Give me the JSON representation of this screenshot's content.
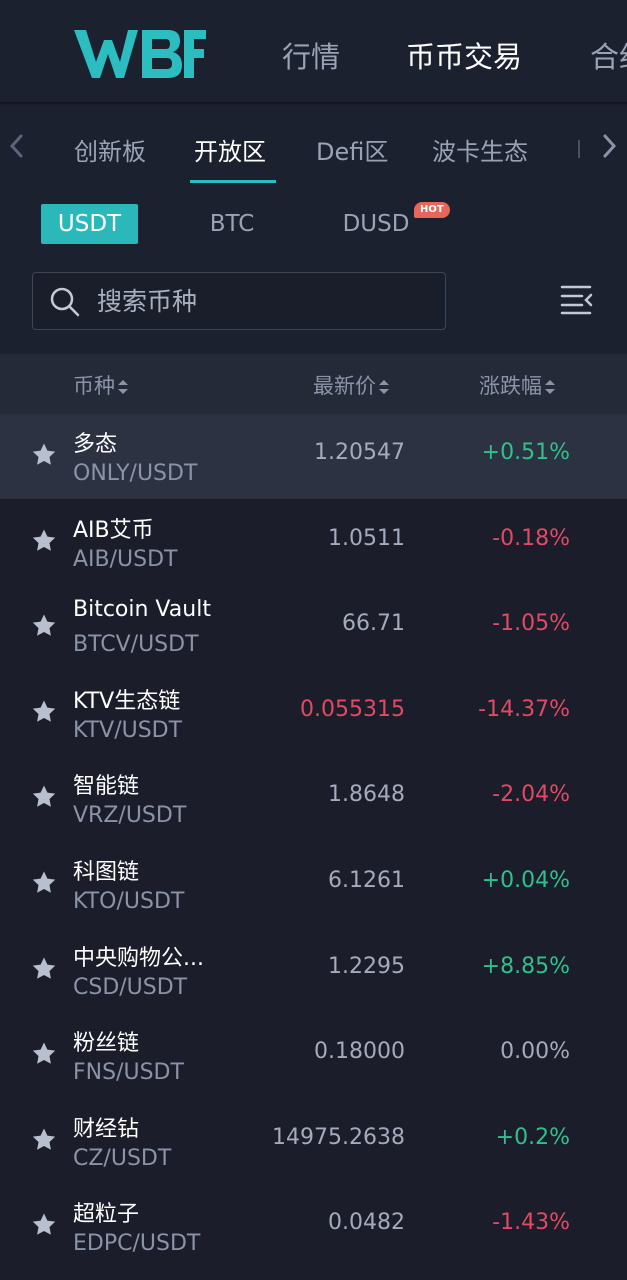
{
  "brand": {
    "logo_text": "WBF",
    "logo_color": "#2cbdc1"
  },
  "nav": {
    "items": [
      {
        "label": "行情",
        "active": false
      },
      {
        "label": "币币交易",
        "active": true
      },
      {
        "label": "合约",
        "active": false
      }
    ]
  },
  "categories": {
    "tabs": [
      {
        "label": "创新板",
        "active": false
      },
      {
        "label": "开放区",
        "active": true
      },
      {
        "label": "Defi区",
        "active": false
      },
      {
        "label": "波卡生态",
        "active": false
      }
    ],
    "prev_icon": "chevron-left-icon",
    "next_icon": "chevron-right-icon"
  },
  "quote": {
    "tabs": [
      {
        "label": "USDT",
        "active": true
      },
      {
        "label": "BTC",
        "active": false
      },
      {
        "label": "DUSD",
        "active": false
      }
    ],
    "hot_badge": "HOT"
  },
  "search": {
    "placeholder": "搜索币种",
    "value": ""
  },
  "columns": {
    "coin": "币种",
    "price": "最新价",
    "change": "涨跌幅"
  },
  "colors": {
    "accent": "#2cbdc1",
    "up": "#2fc18a",
    "down": "#e04a62",
    "background": "#1b1d2a"
  },
  "rows": [
    {
      "name": "多态",
      "pair": "ONLY/USDT",
      "price": "1.20547",
      "change": "+0.51%",
      "trend": "up",
      "highlight": true,
      "price_red": false
    },
    {
      "name": "AIB艾币",
      "pair": "AIB/USDT",
      "price": "1.0511",
      "change": "-0.18%",
      "trend": "down",
      "highlight": false,
      "price_red": false
    },
    {
      "name": "Bitcoin Vault",
      "pair": "BTCV/USDT",
      "price": "66.71",
      "change": "-1.05%",
      "trend": "down",
      "highlight": false,
      "price_red": false
    },
    {
      "name": "KTV生态链",
      "pair": "KTV/USDT",
      "price": "0.055315",
      "change": "-14.37%",
      "trend": "down",
      "highlight": false,
      "price_red": true
    },
    {
      "name": "智能链",
      "pair": "VRZ/USDT",
      "price": "1.8648",
      "change": "-2.04%",
      "trend": "down",
      "highlight": false,
      "price_red": false
    },
    {
      "name": "科图链",
      "pair": "KTO/USDT",
      "price": "6.1261",
      "change": "+0.04%",
      "trend": "up",
      "highlight": false,
      "price_red": false
    },
    {
      "name": "中央购物公...",
      "pair": "CSD/USDT",
      "price": "1.2295",
      "change": "+8.85%",
      "trend": "up",
      "highlight": false,
      "price_red": false
    },
    {
      "name": "粉丝链",
      "pair": "FNS/USDT",
      "price": "0.18000",
      "change": "0.00%",
      "trend": "flat",
      "highlight": false,
      "price_red": false
    },
    {
      "name": "财经钻",
      "pair": "CZ/USDT",
      "price": "14975.2638",
      "change": "+0.2%",
      "trend": "up",
      "highlight": false,
      "price_red": false
    },
    {
      "name": "超粒子",
      "pair": "EDPC/USDT",
      "price": "0.0482",
      "change": "-1.43%",
      "trend": "down",
      "highlight": false,
      "price_red": false
    }
  ]
}
